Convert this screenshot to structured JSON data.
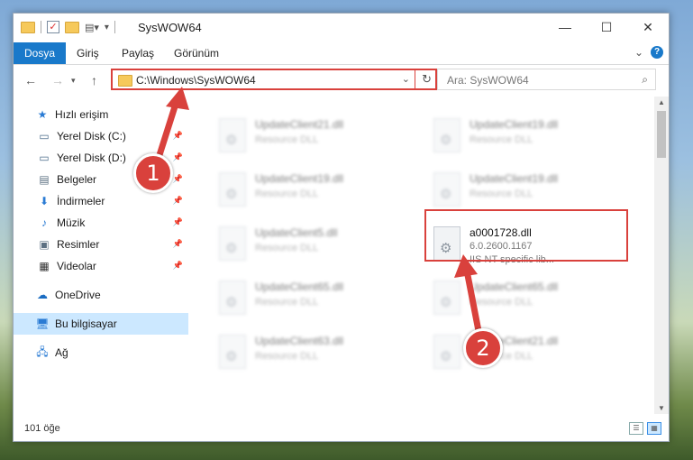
{
  "window": {
    "title": "SysWOW64",
    "controls": {
      "minimize": "—",
      "maximize": "☐",
      "close": "✕"
    }
  },
  "ribbon": {
    "tabs": [
      "Dosya",
      "Giriş",
      "Paylaş",
      "Görünüm"
    ],
    "expand_glyph": "⌄",
    "help_glyph": "?"
  },
  "address_bar": {
    "path": "C:\\Windows\\SysWOW64"
  },
  "search": {
    "placeholder": "Ara: SysWOW64"
  },
  "sidebar": {
    "quick_access": "Hızlı erişim",
    "pinned": [
      {
        "label": "Yerel Disk (C:)",
        "icon": "drive-icon"
      },
      {
        "label": "Yerel Disk (D:)",
        "icon": "drive-icon"
      },
      {
        "label": "Belgeler",
        "icon": "documents-icon"
      },
      {
        "label": "İndirmeler",
        "icon": "downloads-icon"
      },
      {
        "label": "Müzik",
        "icon": "music-icon"
      },
      {
        "label": "Resimler",
        "icon": "pictures-icon"
      },
      {
        "label": "Videolar",
        "icon": "videos-icon"
      }
    ],
    "onedrive": "OneDrive",
    "this_pc": "Bu bilgisayar",
    "network": "Ağ"
  },
  "files": [
    {
      "name": "UpdateClient21.dll",
      "line1": "Resource DLL",
      "line2": ""
    },
    {
      "name": "UpdateClient19.dll",
      "line1": "Resource DLL",
      "line2": ""
    },
    {
      "name": "UpdateClient19.dll",
      "line1": "Resource DLL",
      "line2": ""
    },
    {
      "name": "UpdateClient19.dll",
      "line1": "Resource DLL",
      "line2": ""
    },
    {
      "name": "UpdateClient5.dll",
      "line1": "Resource DLL",
      "line2": ""
    },
    {
      "name": "a0001728.dll",
      "line1": "6.0.2600.1167",
      "line2": "IIS NT specific lib..."
    },
    {
      "name": "UpdateClient65.dll",
      "line1": "Resource DLL",
      "line2": ""
    },
    {
      "name": "UpdateClient65.dll",
      "line1": "Resource DLL",
      "line2": ""
    },
    {
      "name": "UpdateClient63.dll",
      "line1": "Resource DLL",
      "line2": ""
    },
    {
      "name": "UpdateClient21.dll",
      "line1": "Resource DLL",
      "line2": ""
    }
  ],
  "status": {
    "item_count": "101 öğe"
  },
  "annotations": {
    "step1": "1",
    "step2": "2",
    "color": "#d9413c"
  }
}
